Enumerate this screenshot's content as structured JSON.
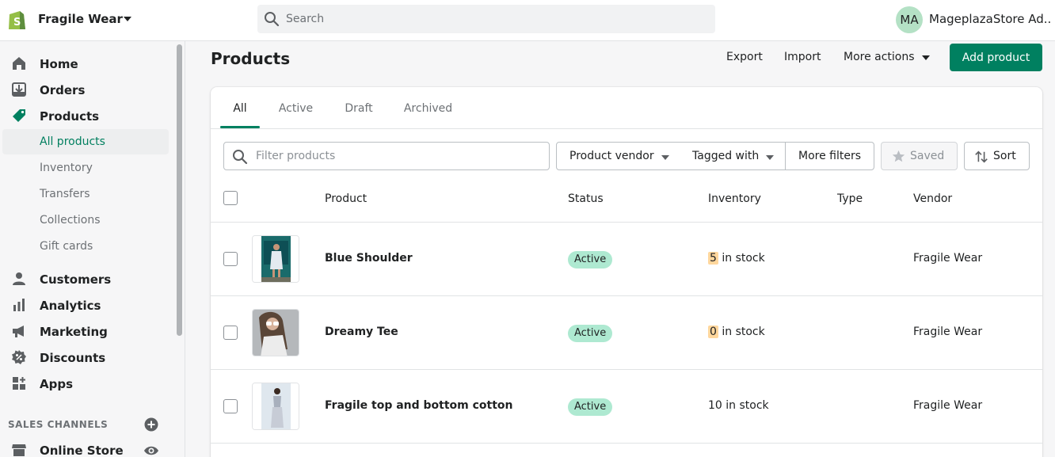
{
  "topbar": {
    "store_name": "Fragile Wear",
    "search_placeholder": "Search",
    "avatar_initials": "MA",
    "account_name": "MageplazaStore Ad..."
  },
  "sidebar": {
    "items": [
      {
        "label": "Home",
        "icon": "home-icon"
      },
      {
        "label": "Orders",
        "icon": "orders-icon"
      },
      {
        "label": "Products",
        "icon": "tag-icon"
      }
    ],
    "product_subitems": [
      "All products",
      "Inventory",
      "Transfers",
      "Collections",
      "Gift cards"
    ],
    "items2": [
      {
        "label": "Customers",
        "icon": "person-icon"
      },
      {
        "label": "Analytics",
        "icon": "bar-chart-icon"
      },
      {
        "label": "Marketing",
        "icon": "megaphone-icon"
      },
      {
        "label": "Discounts",
        "icon": "discount-icon"
      },
      {
        "label": "Apps",
        "icon": "apps-icon"
      }
    ],
    "sales_channels_title": "SALES CHANNELS",
    "online_store": "Online Store"
  },
  "header": {
    "title": "Products",
    "export": "Export",
    "import": "Import",
    "more_actions": "More actions",
    "add_product": "Add product"
  },
  "tabs": [
    "All",
    "Active",
    "Draft",
    "Archived"
  ],
  "filters": {
    "placeholder": "Filter products",
    "vendor": "Product vendor",
    "tagged": "Tagged with",
    "more": "More filters",
    "saved": "Saved",
    "sort": "Sort"
  },
  "columns": [
    "Product",
    "Status",
    "Inventory",
    "Type",
    "Vendor"
  ],
  "rows": [
    {
      "name": "Blue Shoulder",
      "status": "Active",
      "qty": "5",
      "inv_suffix": " in stock",
      "vendor": "Fragile Wear"
    },
    {
      "name": "Dreamy Tee",
      "status": "Active",
      "qty": "0",
      "inv_suffix": " in stock",
      "vendor": "Fragile Wear"
    },
    {
      "name": "Fragile top and bottom cotton",
      "status": "Active",
      "inventory": "10 in stock",
      "vendor": "Fragile Wear"
    }
  ],
  "colors": {
    "accent": "#008060",
    "badge": "#aee9d1",
    "low_stock": "#ffd79d"
  }
}
